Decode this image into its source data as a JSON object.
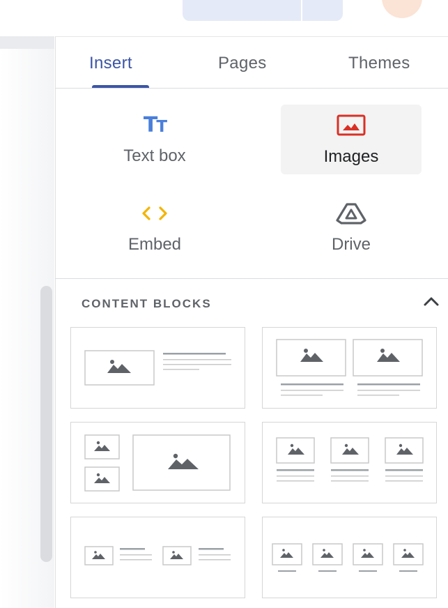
{
  "tabs": [
    {
      "label": "Insert",
      "active": true
    },
    {
      "label": "Pages",
      "active": false
    },
    {
      "label": "Themes",
      "active": false
    }
  ],
  "insert_items": {
    "text_box": {
      "label": "Text box",
      "icon": "text-box-icon"
    },
    "images": {
      "label": "Images",
      "icon": "image-icon",
      "selected": true
    },
    "embed": {
      "label": "Embed",
      "icon": "embed-code-icon"
    },
    "drive": {
      "label": "Drive",
      "icon": "google-drive-icon"
    }
  },
  "content_blocks": {
    "title": "CONTENT BLOCKS",
    "collapse_icon": "chevron-up-icon",
    "layouts": [
      "image-with-text",
      "two-images-with-captions",
      "two-small-images-one-large",
      "three-images-with-captions",
      "two-image-text-pairs",
      "four-images-with-captions"
    ]
  },
  "colors": {
    "accent": "#3c55a5",
    "text_box_icon": "#4a7fdb",
    "image_icon": "#d93025",
    "embed_icon": "#f4b400",
    "drive_icon": "#5f6368"
  }
}
